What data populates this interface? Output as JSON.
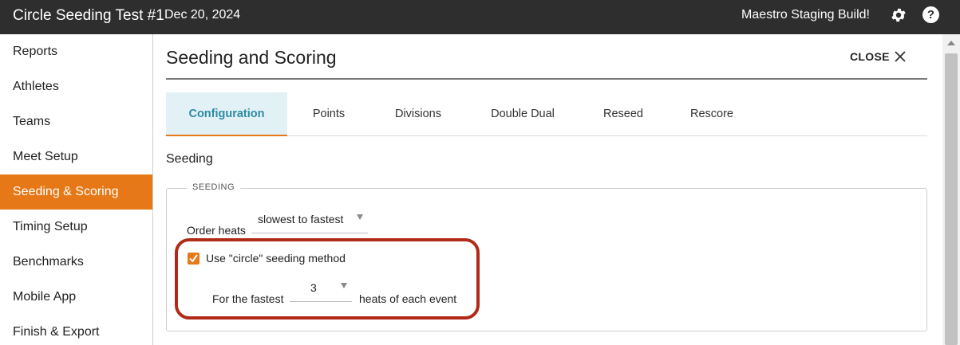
{
  "topbar": {
    "title": "Circle Seeding Test #1",
    "date": "Dec 20, 2024",
    "build_label": "Maestro Staging Build!",
    "help_glyph": "?",
    "icons": [
      "gear-icon",
      "help-icon"
    ]
  },
  "sidebar": {
    "items": [
      {
        "label": "Reports"
      },
      {
        "label": "Athletes"
      },
      {
        "label": "Teams"
      },
      {
        "label": "Meet Setup"
      },
      {
        "label": "Seeding & Scoring",
        "active": true
      },
      {
        "label": "Timing Setup"
      },
      {
        "label": "Benchmarks"
      },
      {
        "label": "Mobile App"
      },
      {
        "label": "Finish & Export"
      }
    ],
    "active_color": "#e67817"
  },
  "main": {
    "page_title": "Seeding and Scoring",
    "close_label": "CLOSE",
    "tabs": [
      {
        "label": "Configuration",
        "active": true
      },
      {
        "label": "Points"
      },
      {
        "label": "Divisions"
      },
      {
        "label": "Double Dual"
      },
      {
        "label": "Reseed"
      },
      {
        "label": "Rescore"
      }
    ],
    "section_heading": "Seeding",
    "seeding": {
      "legend": "SEEDING",
      "order_heats_label": "Order heats",
      "order_heats_value": "slowest to fastest",
      "circle_checkbox_label": "Use \"circle\" seeding method",
      "circle_checked": true,
      "fastest_prefix": "For the fastest",
      "fastest_value": "3",
      "fastest_suffix": "heats of each event"
    }
  },
  "colors": {
    "topbar": "#2e2e2e",
    "accent_orange": "#e67817",
    "tab_active_bg": "#e2f1f5",
    "tab_active_text": "#2d8aa3",
    "highlight_outline": "#b02a17"
  }
}
